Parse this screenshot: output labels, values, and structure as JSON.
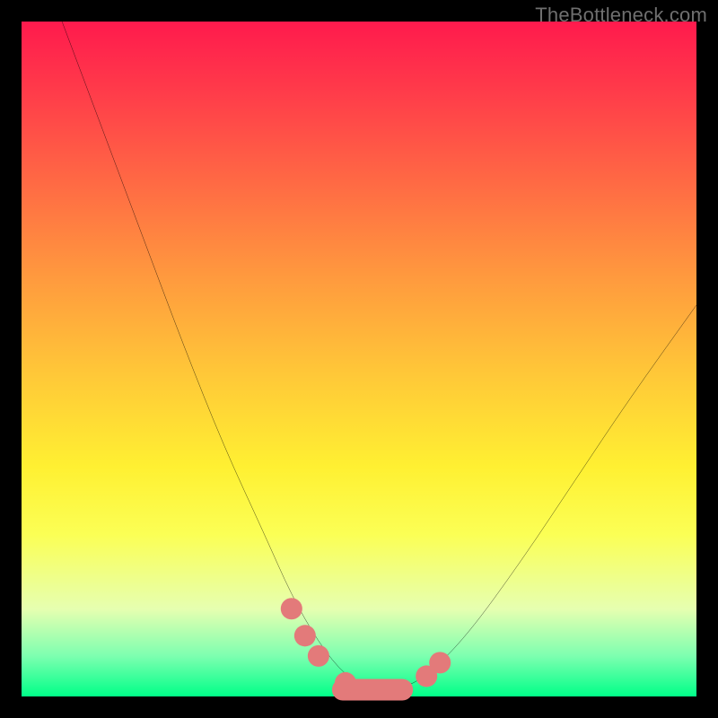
{
  "watermark": {
    "text": "TheBottleneck.com"
  },
  "chart_data": {
    "type": "line",
    "title": "",
    "xlabel": "",
    "ylabel": "",
    "xlim": [
      0,
      100
    ],
    "ylim": [
      0,
      100
    ],
    "background": "rainbow-vertical-gradient",
    "series": [
      {
        "name": "bottleneck-curve",
        "stroke": "#000000",
        "x": [
          6,
          12,
          18,
          24,
          30,
          36,
          40,
          44,
          48,
          52,
          56,
          60,
          66,
          74,
          82,
          90,
          100
        ],
        "values": [
          100,
          84,
          68,
          52,
          37,
          24,
          15,
          8,
          3,
          1,
          1,
          3,
          9,
          20,
          32,
          44,
          58
        ]
      }
    ],
    "markers": {
      "name": "highlight-dots",
      "color": "#e37a7a",
      "points": [
        {
          "x": 40,
          "y": 13,
          "r": 1.6
        },
        {
          "x": 42,
          "y": 9,
          "r": 1.6
        },
        {
          "x": 44,
          "y": 6,
          "r": 1.6
        },
        {
          "x": 48,
          "y": 2,
          "r": 1.6
        },
        {
          "x": 52,
          "y": 1,
          "r": 1.6
        },
        {
          "x": 56,
          "y": 1,
          "r": 1.6
        },
        {
          "x": 60,
          "y": 3,
          "r": 1.6
        },
        {
          "x": 62,
          "y": 5,
          "r": 1.6
        }
      ],
      "pill": {
        "x0": 46,
        "x1": 58,
        "y": 1,
        "r": 1.6
      }
    }
  }
}
